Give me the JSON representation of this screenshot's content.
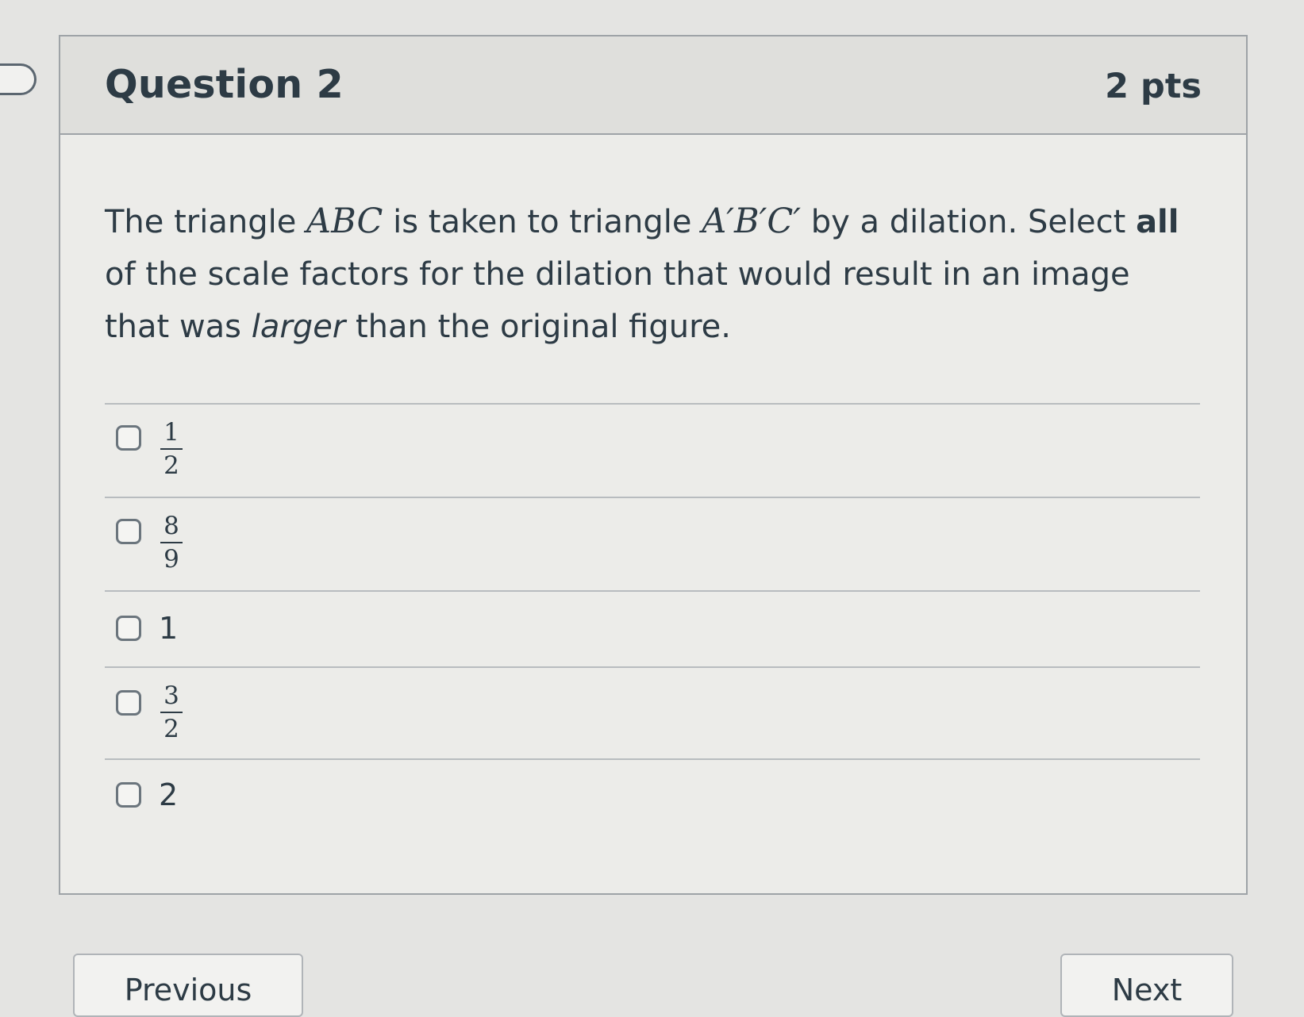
{
  "question": {
    "title": "Question 2",
    "points": "2 pts",
    "text": {
      "part1": "The triangle ",
      "math1": "ABC",
      "part2": " is taken to triangle ",
      "math2": "A′B′C′",
      "part3": " by a dilation. Select ",
      "bold": "all",
      "part4": " of the scale factors for the dilation that would result in an image that was ",
      "italic": "larger",
      "part5": " than the original figure."
    },
    "answers": [
      {
        "numerator": "1",
        "denominator": "2",
        "checked": false
      },
      {
        "numerator": "8",
        "denominator": "9",
        "checked": false
      },
      {
        "value": "1",
        "checked": false
      },
      {
        "numerator": "3",
        "denominator": "2",
        "checked": false
      },
      {
        "value": "2",
        "checked": false
      }
    ]
  },
  "navigation": {
    "previous_label": "Previous",
    "next_label": "Next"
  }
}
